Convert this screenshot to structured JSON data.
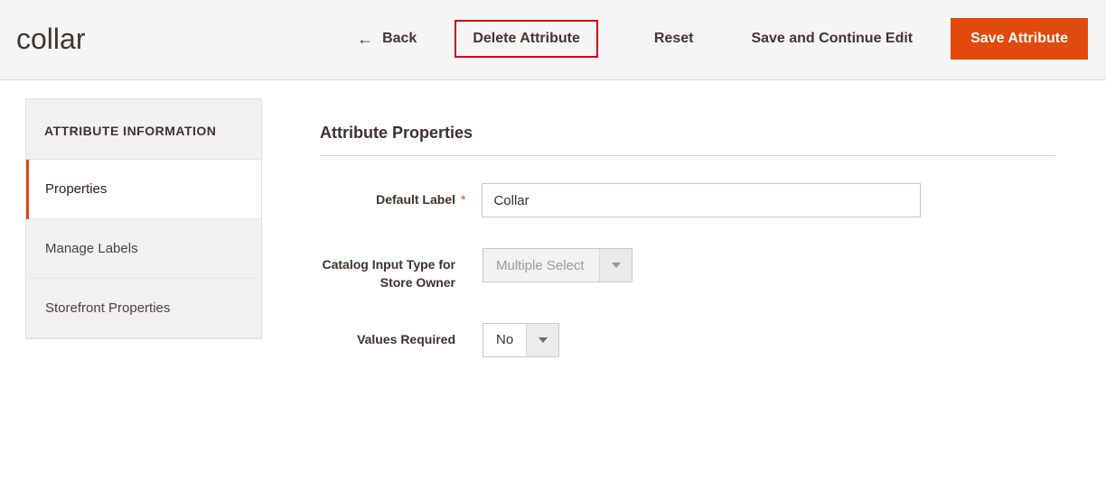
{
  "header": {
    "title": "collar",
    "back_label": "Back",
    "delete_label": "Delete Attribute",
    "reset_label": "Reset",
    "save_continue_label": "Save and Continue Edit",
    "save_label": "Save Attribute"
  },
  "sidebar": {
    "heading": "ATTRIBUTE INFORMATION",
    "items": [
      {
        "label": "Properties",
        "active": true
      },
      {
        "label": "Manage Labels",
        "active": false
      },
      {
        "label": "Storefront Properties",
        "active": false
      }
    ]
  },
  "section": {
    "title": "Attribute Properties",
    "fields": {
      "default_label": {
        "label": "Default Label",
        "value": "Collar",
        "required": true
      },
      "catalog_input_type": {
        "label": "Catalog Input Type for Store Owner",
        "value": "Multiple Select",
        "disabled": true
      },
      "values_required": {
        "label": "Values Required",
        "value": "No"
      }
    }
  },
  "glyphs": {
    "required": "*"
  }
}
